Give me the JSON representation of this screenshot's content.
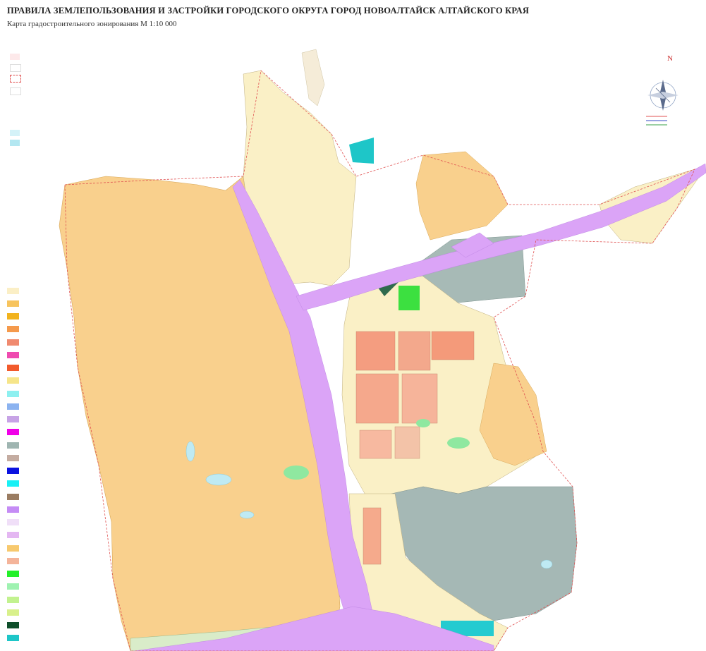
{
  "header": {
    "title": "ПРАВИЛА ЗЕМЛЕПОЛЬЗОВАНИЯ И ЗАСТРОЙКИ ГОРОДСКОГО ОКРУГА ГОРОД НОВОАЛТАЙСК АЛТАЙСКОГО КРАЯ",
    "subtitle": "Карта градостроительного зонирования М 1:10 000"
  },
  "compass": {
    "north_label": "N"
  },
  "colors": {
    "residential_low": "#fbe3a6",
    "residential_sand": "#f7cf86",
    "residential_block": "#f6a27f",
    "industrial": "#a3b7b3",
    "transport": "#d9a3f5",
    "recreation_green": "#8ee68a",
    "water": "#bfeaf3",
    "boundary": "#e05050"
  },
  "chart_data": {
    "type": "map",
    "legend_top": [
      {
        "label": "",
        "color": "#fde9ea"
      },
      {
        "label": "",
        "color": "#ffffff"
      },
      {
        "label": "",
        "color": "#ffffff"
      }
    ],
    "legend_water": [
      {
        "label": "",
        "color": "#d4f2f8"
      },
      {
        "label": "",
        "color": "#b3e7f1"
      }
    ],
    "legend_zones": [
      {
        "label": "",
        "color": "#fbefc6"
      },
      {
        "label": "",
        "color": "#f7c45e"
      },
      {
        "label": "",
        "color": "#f2b31d"
      },
      {
        "label": "",
        "color": "#f59a4c"
      },
      {
        "label": "",
        "color": "#f08a6f"
      },
      {
        "label": "",
        "color": "#ef4bb0"
      },
      {
        "label": "",
        "color": "#f25a2c"
      },
      {
        "label": "",
        "color": "#f6e58a"
      },
      {
        "label": "",
        "color": "#8ef0f0"
      },
      {
        "label": "",
        "color": "#8cb3f0"
      },
      {
        "label": "",
        "color": "#c7a3e6"
      },
      {
        "label": "",
        "color": "#f000e8"
      },
      {
        "label": "",
        "color": "#9fb5b1"
      },
      {
        "label": "",
        "color": "#c4aca1"
      },
      {
        "label": "",
        "color": "#0b12e0"
      },
      {
        "label": "",
        "color": "#19f0f5"
      },
      {
        "label": "",
        "color": "#9a7c62"
      },
      {
        "label": "",
        "color": "#c58cf5"
      },
      {
        "label": "",
        "color": "#f0dff8"
      },
      {
        "label": "",
        "color": "#e4b7f2"
      },
      {
        "label": "",
        "color": "#f7c96e"
      },
      {
        "label": "",
        "color": "#f4b49a"
      },
      {
        "label": "",
        "color": "#24f02a"
      },
      {
        "label": "",
        "color": "#9ff2b1"
      },
      {
        "label": "",
        "color": "#c2f28f"
      },
      {
        "label": "",
        "color": "#d8f08b"
      },
      {
        "label": "",
        "color": "#0f4f2b"
      },
      {
        "label": "",
        "color": "#1ec6c8"
      }
    ],
    "title": "",
    "xlabel": "",
    "ylabel": ""
  }
}
